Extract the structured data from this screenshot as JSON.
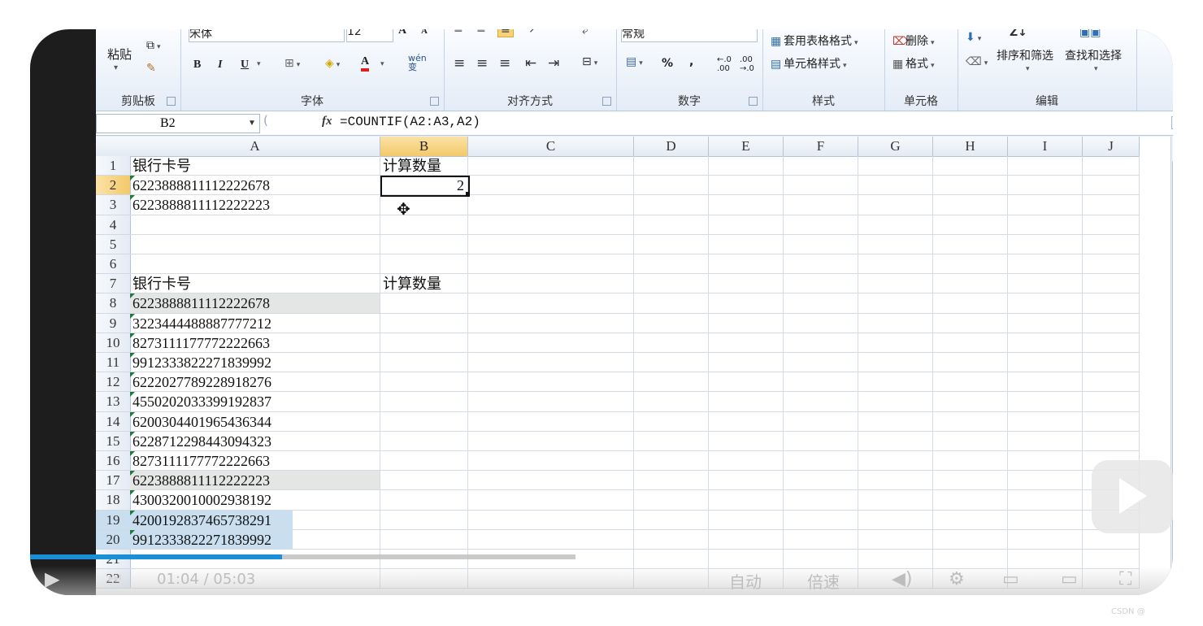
{
  "ribbon": {
    "clipboard": {
      "label": "剪贴板",
      "paste": "粘贴"
    },
    "font": {
      "label": "字体",
      "name": "宋体",
      "size": "12",
      "bold": "B",
      "italic": "I",
      "underline": "U",
      "grow": "A",
      "shrink": "A",
      "font_color": "A",
      "phonetic": "wén\n变"
    },
    "alignment": {
      "label": "对齐方式"
    },
    "number": {
      "label": "数字",
      "format": "常规",
      "percent": "%",
      "comma": ",",
      "inc_decimal": "←.0\n.00",
      "dec_decimal": ".00\n→.0"
    },
    "styles": {
      "label": "样式",
      "table_format": "套用表格格式",
      "cell_styles": "单元格样式"
    },
    "cells": {
      "label": "单元格",
      "delete": "删除",
      "format": "格式"
    },
    "editing": {
      "label": "编辑",
      "sort_filter": "排序和筛选",
      "find_select": "查找和选择"
    }
  },
  "formula_bar": {
    "name_box": "B2",
    "fx": "fx",
    "formula": "=COUNTIF(A2:A3,A2)"
  },
  "grid": {
    "columns": [
      "A",
      "B",
      "C",
      "D",
      "E",
      "F",
      "G",
      "H",
      "I",
      "J"
    ],
    "selected_column": "B",
    "rows": [
      "1",
      "2",
      "3",
      "4",
      "5",
      "6",
      "7",
      "8",
      "9",
      "10",
      "11",
      "12",
      "13",
      "14",
      "15",
      "16",
      "17",
      "18",
      "19",
      "20",
      "21",
      "22"
    ],
    "selected_row": "2",
    "cells": {
      "A1": "银行卡号",
      "B1": "计算数量",
      "A2": "6223888811112222678",
      "B2": "2",
      "A3": "6223888811112222223",
      "A7": "银行卡号",
      "B7": "计算数量",
      "A8": "6223888811112222678",
      "A9": "3223444488887777212",
      "A10": "8273111177772222663",
      "A11": "9912333822271839992",
      "A12": "6222027789228918276",
      "A13": "4550202033399192837",
      "A14": "6200304401965436344",
      "A15": "6228712298443094323",
      "A16": "8273111177772222663",
      "A17": "6223888811112222223",
      "A18": "4300320010002938192",
      "A19": "4200192837465738291",
      "A20": "9912333822271839992"
    }
  },
  "video": {
    "progress": 0.462,
    "time": "01:04 / 05:03",
    "auto": "自动",
    "speed": "倍速"
  },
  "colors": {
    "accent": "#1a8fd8",
    "selected_header": "#f3c96a"
  }
}
